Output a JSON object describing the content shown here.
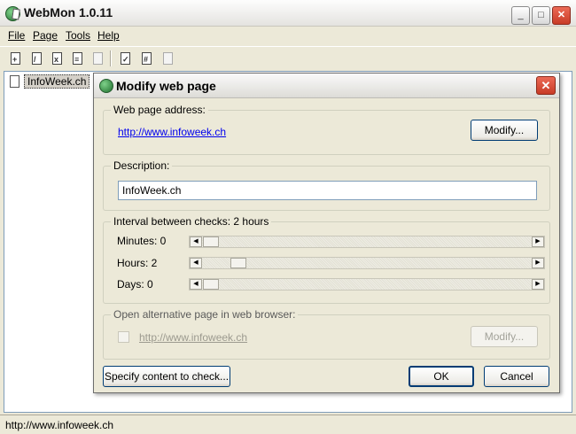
{
  "app": {
    "title": "WebMon 1.0.11",
    "window_buttons": {
      "minimize": "_",
      "maximize": "□",
      "close": "✕"
    }
  },
  "menu": [
    "File",
    "Page",
    "Tools",
    "Help"
  ],
  "toolbar": {
    "icons": [
      "new-page-icon",
      "edit-page-icon",
      "delete-page-icon",
      "copy-icon",
      "paste-icon",
      "check-page-icon",
      "check-all-icon",
      "settings-icon"
    ]
  },
  "pages": [
    {
      "label": "InfoWeek.ch"
    }
  ],
  "statusbar": {
    "text": "http://www.infoweek.ch"
  },
  "dialog": {
    "title": "Modify web page",
    "close": "✕",
    "address_group": {
      "title": "Web page address:",
      "url": "http://www.infoweek.ch",
      "modify_label": "Modify..."
    },
    "description_group": {
      "title": "Description:",
      "value": "InfoWeek.ch"
    },
    "interval_group": {
      "title": "Interval between checks: 2 hours",
      "minutes_label": "Minutes: 0",
      "hours_label": "Hours: 2",
      "days_label": "Days: 0",
      "minutes_value": 0,
      "hours_value": 2,
      "days_value": 0
    },
    "alternative_group": {
      "title": "Open alternative page in web browser:",
      "checked": false,
      "url": "http://www.infoweek.ch",
      "modify_label": "Modify...",
      "enabled": false
    },
    "buttons": {
      "specify": "Specify content to check...",
      "ok": "OK",
      "cancel": "Cancel"
    }
  }
}
